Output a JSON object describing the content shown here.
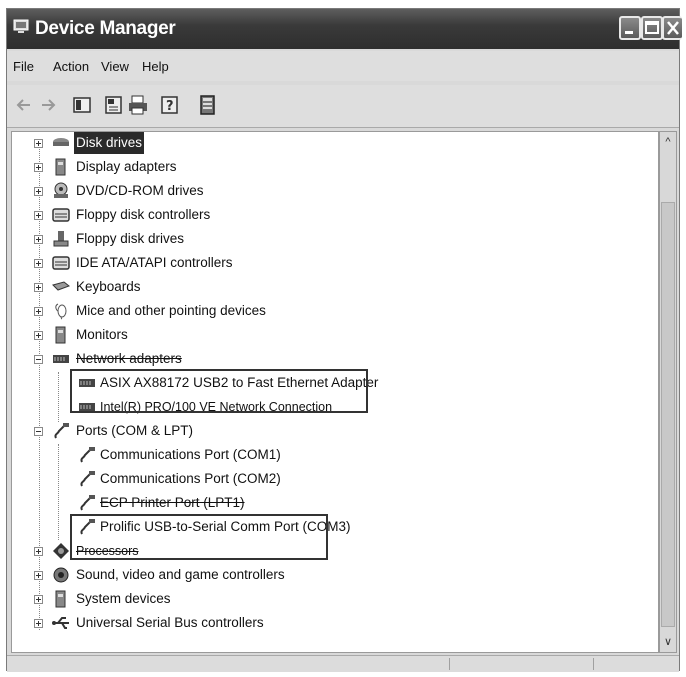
{
  "window": {
    "title": "Device Manager"
  },
  "menu": [
    "File",
    "Action",
    "View",
    "Help"
  ],
  "toolbar": {
    "buttons": [
      "back-icon",
      "forward-icon",
      "show-hide-tree-icon",
      "properties-icon",
      "print-icon",
      "help-icon",
      "scan-hardware-icon"
    ]
  },
  "tree": {
    "categories": [
      {
        "label": "Disk drives",
        "icon": "disk-drive-icon",
        "expanded": false,
        "selected": true
      },
      {
        "label": "Display adapters",
        "icon": "display-adapter-icon",
        "expanded": false
      },
      {
        "label": "DVD/CD-ROM drives",
        "icon": "dvd-drive-icon",
        "expanded": false
      },
      {
        "label": "Floppy disk controllers",
        "icon": "floppy-controller-icon",
        "expanded": false
      },
      {
        "label": "Floppy disk drives",
        "icon": "floppy-drive-icon",
        "expanded": false
      },
      {
        "label": "IDE ATA/ATAPI controllers",
        "icon": "ide-controller-icon",
        "expanded": false
      },
      {
        "label": "Keyboards",
        "icon": "keyboard-icon",
        "expanded": false
      },
      {
        "label": "Mice and other pointing devices",
        "icon": "mouse-icon",
        "expanded": false
      },
      {
        "label": "Monitors",
        "icon": "monitor-icon",
        "expanded": false
      },
      {
        "label": "Network adapters",
        "icon": "network-adapter-icon",
        "expanded": true
      },
      {
        "label": "Ports (COM & LPT)",
        "icon": "port-icon",
        "expanded": true
      },
      {
        "label": "Processors",
        "icon": "processor-icon",
        "expanded": false
      },
      {
        "label": "Sound, video and game controllers",
        "icon": "sound-icon",
        "expanded": false
      },
      {
        "label": "System devices",
        "icon": "system-device-icon",
        "expanded": false
      },
      {
        "label": "Universal Serial Bus controllers",
        "icon": "usb-icon",
        "expanded": false
      }
    ],
    "network_children": [
      "ASIX AX88172 USB2 to Fast Ethernet Adapter",
      "Intel(R) PRO/100 VE Network Connection"
    ],
    "port_children": [
      "Communications Port (COM1)",
      "Communications Port (COM2)",
      "ECP Printer Port (LPT1)",
      "Prolific USB-to-Serial Comm Port (COM3)"
    ]
  }
}
